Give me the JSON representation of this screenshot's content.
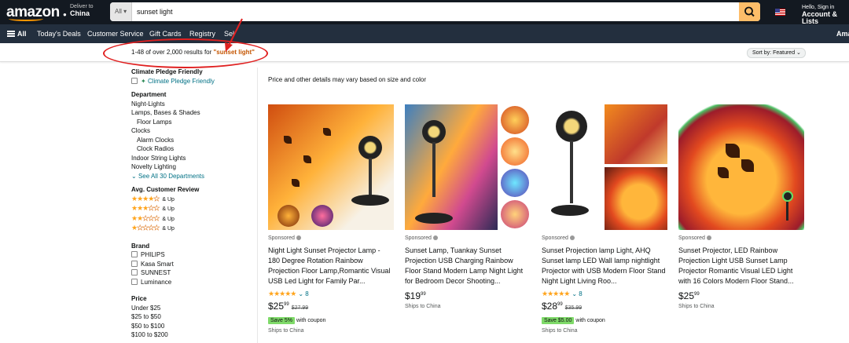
{
  "header": {
    "logo": "amazon",
    "deliver_line1": "Deliver to",
    "deliver_line2": "China",
    "search_category": "All",
    "search_value": "sunset light",
    "account_line1": "Hello, Sign in",
    "account_line2": "Account & Lists"
  },
  "nav": {
    "all": "All",
    "items": [
      "Today's Deals",
      "Customer Service",
      "Gift Cards",
      "Registry",
      "Sel"
    ],
    "right": "Ama"
  },
  "results": {
    "count_text": "1-48 of over 2,000 results for ",
    "query": "\"sunset light\"",
    "sort": "Sort by: Featured"
  },
  "sidebar": {
    "climate_head": "Climate Pledge Friendly",
    "climate_item": "Climate Pledge Friendly",
    "department_head": "Department",
    "departments": [
      "Night-Lights",
      "Lamps, Bases & Shades",
      "Floor Lamps",
      "Clocks",
      "Alarm Clocks",
      "Clock Radios",
      "Indoor String Lights",
      "Novelty Lighting"
    ],
    "see_all": "See All 30 Departments",
    "review_head": "Avg. Customer Review",
    "review_up": "& Up",
    "brand_head": "Brand",
    "brands": [
      "PHILIPS",
      "Kasa Smart",
      "SUNNEST",
      "Luminance"
    ],
    "price_head": "Price",
    "prices": [
      "Under $25",
      "$25 to $50",
      "$50 to $100",
      "$100 to $200"
    ]
  },
  "notice": "Price and other details may vary based on size and color",
  "products": [
    {
      "sponsored": "Sponsored",
      "title": "Night Light Sunset Projector Lamp - 180 Degree Rotation Rainbow Projection Floor Lamp,Romantic Visual USB Led Light for Family Par...",
      "rating_count": "8",
      "price_whole": "$25",
      "price_frac": "99",
      "list_price": "$27.99",
      "badge": "Save 5%",
      "coupon": "with coupon",
      "ship": "Ships to China"
    },
    {
      "sponsored": "Sponsored",
      "title": "Sunset Lamp, Tuankay Sunset Projection USB Charging Rainbow Floor Stand Modern Lamp Night Light for Bedroom Decor Shooting...",
      "price_whole": "$19",
      "price_frac": "99",
      "ship": "Ships to China"
    },
    {
      "sponsored": "Sponsored",
      "title": "Sunset Projection lamp Light, AHQ Sunset lamp LED Wall lamp nightlight Projector with USB Modern Floor Stand Night Light Living Roo...",
      "rating_count": "8",
      "price_whole": "$28",
      "price_frac": "99",
      "list_price": "$35.99",
      "badge": "Save $5.00",
      "coupon": "with coupon",
      "ship": "Ships to China"
    },
    {
      "sponsored": "Sponsored",
      "title": "Sunset Projector, LED Rainbow Projection Light USB Sunset Lamp Projector Romantic Visual LED Light with 16 Colors Modern Floor Stand...",
      "price_whole": "$25",
      "price_frac": "99",
      "ship": "Ships to China"
    }
  ],
  "colors": {
    "topbar": "#131921",
    "navbar": "#232f3e",
    "search_button": "#febd69",
    "query": "#c45500",
    "link": "#007185",
    "star": "#ffa41c",
    "badge": "#7fda69",
    "annotation": "#e02020"
  }
}
